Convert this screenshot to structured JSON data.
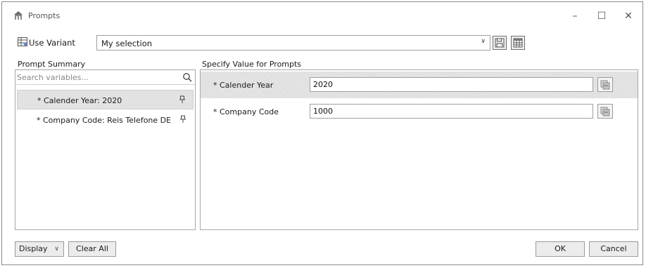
{
  "window": {
    "title": "Prompts",
    "minimize": "–",
    "maximize": "☐",
    "close": "✕"
  },
  "variant": {
    "label": "Use Variant",
    "selected": "My selection"
  },
  "prompt_summary": {
    "heading": "Prompt Summary",
    "search_placeholder": "Search variables...",
    "items": [
      {
        "label": "* Calender Year: 2020",
        "selected": true
      },
      {
        "label": "* Company Code: Reis Telefone DE",
        "selected": false
      }
    ]
  },
  "specify": {
    "heading": "Specify Value for Prompts",
    "rows": [
      {
        "label": "* Calender Year",
        "value": "2020",
        "selected": true
      },
      {
        "label": "* Company Code",
        "value": "1000",
        "selected": false
      }
    ]
  },
  "footer": {
    "display_label": "Display",
    "clear_all_label": "Clear All",
    "ok_label": "OK",
    "cancel_label": "Cancel"
  }
}
